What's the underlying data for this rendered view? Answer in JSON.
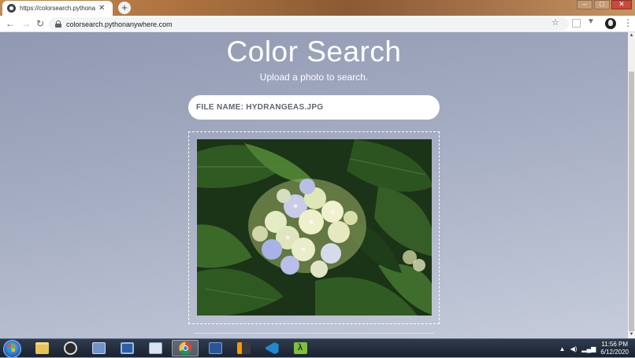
{
  "browser": {
    "tab_title": "https://colorsearch.pythonanywhere.com",
    "url": "colorsearch.pythonanywhere.com"
  },
  "page": {
    "title": "Color Search",
    "subtitle": "Upload a photo to search.",
    "file_label": "FILE NAME: HYDRANGEAS.JPG"
  },
  "taskbar": {
    "time": "11:56 PM",
    "date": "6/12/2020",
    "apps": [
      "windows-explorer",
      "obs",
      "network-tool",
      "remote-desktop",
      "image-viewer",
      "chrome",
      "powershell",
      "sublime-text",
      "vs-code",
      "lambda-app"
    ]
  },
  "colors": {
    "page_bg": "#9aa3b8",
    "accent_white": "#ffffff",
    "pill_text": "#5f6670"
  }
}
